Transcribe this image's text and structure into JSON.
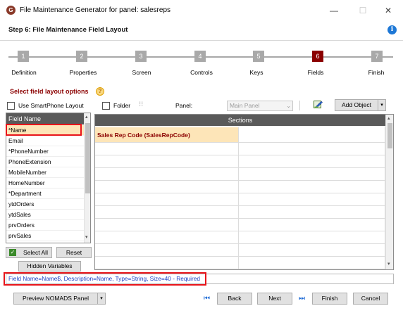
{
  "window": {
    "title": "File Maintenance Generator for panel: salesreps",
    "minimize": "—",
    "maximize": "☐",
    "close": "✕",
    "app_icon": "G"
  },
  "header": {
    "step_title": "Step 6: File Maintenance Field Layout",
    "info_icon": "i"
  },
  "wizard": {
    "steps": [
      {
        "num": "1",
        "label": "Definition"
      },
      {
        "num": "2",
        "label": "Properties"
      },
      {
        "num": "3",
        "label": "Screen"
      },
      {
        "num": "4",
        "label": "Controls"
      },
      {
        "num": "5",
        "label": "Keys"
      },
      {
        "num": "6",
        "label": "Fields"
      },
      {
        "num": "7",
        "label": "Finish"
      }
    ],
    "active_step": 6
  },
  "section": {
    "label": "Select field layout options",
    "help_icon": "?"
  },
  "toolbar": {
    "smartphone_label": "Use SmartPhone Layout",
    "smartphone_checked": false,
    "folder_label": "Folder",
    "folder_checked": false,
    "panel_label": "Panel:",
    "panel_value": "Main Panel",
    "add_object_label": "Add Object"
  },
  "fieldlist": {
    "header": "Field Name",
    "items": [
      "*Name",
      "Email",
      "*PhoneNumber",
      "PhoneExtension",
      "MobileNumber",
      "HomeNumber",
      "*Department",
      "ytdOrders",
      "ytdSales",
      "prvOrders",
      "prvSales"
    ],
    "selected_index": 0,
    "select_all_label": "Select All",
    "reset_label": "Reset",
    "hidden_vars_label": "Hidden Variables"
  },
  "grid": {
    "header": "Sections",
    "placed_field": "Sales Rep Code (SalesRepCode)"
  },
  "status": {
    "text": "Field Name=Name$,  Description=Name,  Type=String,  Size=40 - Required"
  },
  "footer": {
    "preview_label": "Preview NOMADS Panel",
    "back_label": "Back",
    "next_label": "Next",
    "finish_label": "Finish",
    "cancel_label": "Cancel"
  },
  "colors": {
    "accent_dark_red": "#8b0000",
    "selection_bg": "#fde5b8",
    "highlight_red": "#e8141a",
    "status_blue": "#1a3fc4"
  }
}
